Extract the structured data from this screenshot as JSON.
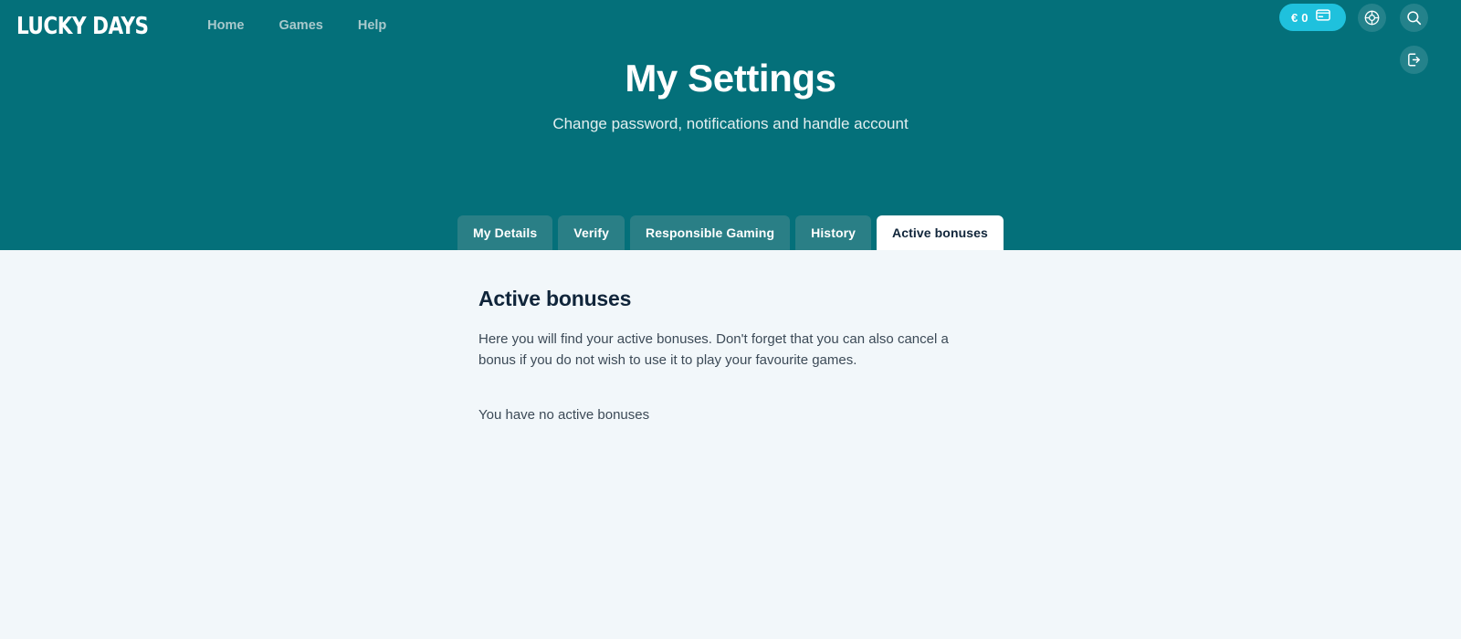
{
  "brand": {
    "logo_text": "LUCKY DAYS"
  },
  "nav": {
    "items": [
      {
        "label": "Home"
      },
      {
        "label": "Games"
      },
      {
        "label": "Help"
      }
    ]
  },
  "top_right": {
    "balance": "€ 0",
    "balance_icon": "credit-card-icon",
    "support_icon": "support-icon",
    "search_icon": "search-icon",
    "logout_icon": "logout-icon"
  },
  "hero": {
    "title": "My Settings",
    "subtitle": "Change password, notifications and handle account"
  },
  "tabs": [
    {
      "label": "My Details",
      "active": false
    },
    {
      "label": "Verify",
      "active": false
    },
    {
      "label": "Responsible Gaming",
      "active": false
    },
    {
      "label": "History",
      "active": false
    },
    {
      "label": "Active bonuses",
      "active": true
    }
  ],
  "main": {
    "title": "Active bonuses",
    "description": "Here you will find your active bonuses. Don't forget that you can also cancel a bonus if you do not wish to use it to play your favourite games.",
    "empty_message": "You have no active bonuses"
  },
  "colors": {
    "hero_teal": "#04707a",
    "tab_inactive": "#2a7f86",
    "accent_cyan": "#1fc1dd",
    "page_background": "#f2f7fa",
    "text_dark": "#10253a"
  }
}
